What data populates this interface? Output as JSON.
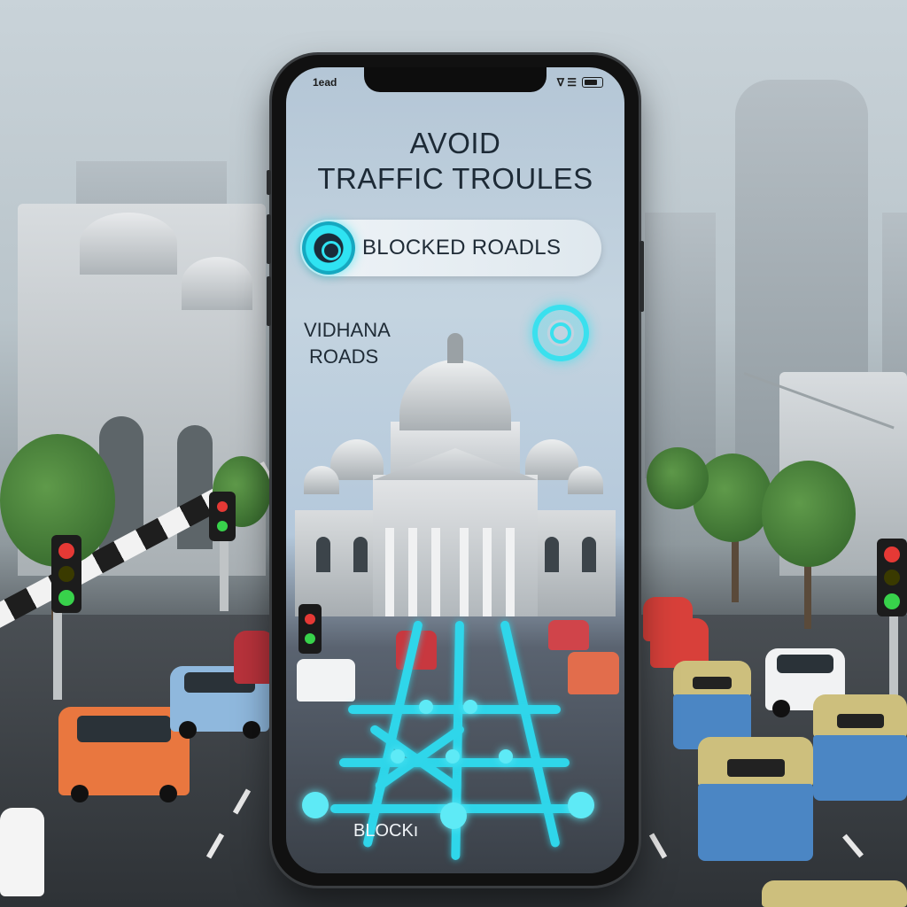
{
  "status_bar": {
    "time": "1ead",
    "right_glyphs": "∇ ☰"
  },
  "headline": {
    "line1": "AVOID",
    "line2": "TRAFFIC TROULES"
  },
  "blocked_roads_pill": {
    "label": "BLOCKED ROADLS",
    "icon": "route-marker-icon"
  },
  "place_label": {
    "line1": "VIDHANA",
    "line2": "ROADS"
  },
  "gear_button": {
    "icon": "gear-icon"
  },
  "map": {
    "label": "BLOCKı"
  },
  "colors": {
    "accent_cyan": "#2fd6ea",
    "headline_text": "#1d2a36",
    "phone_body": "#111111"
  }
}
